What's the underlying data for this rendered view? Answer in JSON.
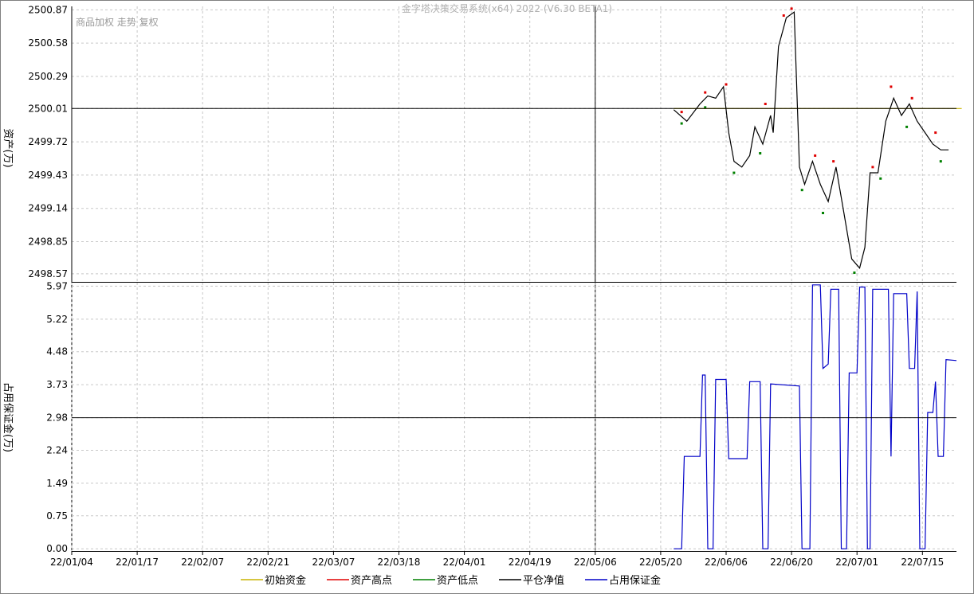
{
  "window": {
    "title": "金字塔决策交易系统(x64) 2022 (V6.30 BETA1)"
  },
  "toolbar": {
    "label": "商品加权 走势 复权"
  },
  "colors": {
    "initial_capital": "#c8b400",
    "asset_high": "#e00000",
    "asset_low": "#008000",
    "close_equity": "#000000",
    "margin_used": "#0000c8",
    "grid": "#c8c8c8",
    "crosshair": "#000000"
  },
  "chart_data": [
    {
      "type": "line",
      "ylabel": "资产(万)",
      "yticks": [
        "2500.87",
        "2500.58",
        "2500.29",
        "2500.01",
        "2499.72",
        "2499.43",
        "2499.14",
        "2498.85",
        "2498.57"
      ],
      "ylim": [
        2498.5,
        2500.9
      ],
      "grid": true,
      "series": [
        {
          "name": "初始资金",
          "values": [
            [
              23,
              2500.01
            ],
            [
              34,
              2500.01
            ]
          ]
        },
        {
          "name": "平仓净值",
          "values": [
            [
              23.0,
              2500.0
            ],
            [
              23.5,
              2499.9
            ],
            [
              24.0,
              2500.05
            ],
            [
              24.3,
              2500.12
            ],
            [
              24.6,
              2500.1
            ],
            [
              24.9,
              2500.2
            ],
            [
              25.1,
              2499.8
            ],
            [
              25.3,
              2499.55
            ],
            [
              25.6,
              2499.5
            ],
            [
              25.9,
              2499.6
            ],
            [
              26.1,
              2499.85
            ],
            [
              26.4,
              2499.7
            ],
            [
              26.7,
              2499.95
            ],
            [
              26.8,
              2499.8
            ],
            [
              27.0,
              2500.55
            ],
            [
              27.3,
              2500.8
            ],
            [
              27.6,
              2500.85
            ],
            [
              27.8,
              2499.5
            ],
            [
              28.0,
              2499.35
            ],
            [
              28.3,
              2499.55
            ],
            [
              28.6,
              2499.35
            ],
            [
              28.9,
              2499.2
            ],
            [
              29.2,
              2499.5
            ],
            [
              29.5,
              2499.1
            ],
            [
              29.8,
              2498.7
            ],
            [
              30.1,
              2498.62
            ],
            [
              30.3,
              2498.8
            ],
            [
              30.5,
              2499.45
            ],
            [
              30.8,
              2499.45
            ],
            [
              31.1,
              2499.9
            ],
            [
              31.4,
              2500.1
            ],
            [
              31.7,
              2499.95
            ],
            [
              32.0,
              2500.05
            ],
            [
              32.3,
              2499.9
            ],
            [
              32.6,
              2499.8
            ],
            [
              32.9,
              2499.7
            ],
            [
              33.2,
              2499.65
            ],
            [
              33.5,
              2499.65
            ]
          ]
        },
        {
          "name": "资产高点",
          "values": [
            [
              23.3,
              2499.98
            ],
            [
              24.2,
              2500.15
            ],
            [
              25.0,
              2500.22
            ],
            [
              26.5,
              2500.05
            ],
            [
              27.2,
              2500.82
            ],
            [
              27.5,
              2500.88
            ],
            [
              28.4,
              2499.6
            ],
            [
              29.1,
              2499.55
            ],
            [
              30.6,
              2499.5
            ],
            [
              31.3,
              2500.2
            ],
            [
              32.1,
              2500.1
            ],
            [
              33.0,
              2499.8
            ]
          ]
        },
        {
          "name": "资产低点",
          "values": [
            [
              23.3,
              2499.88
            ],
            [
              24.2,
              2500.02
            ],
            [
              25.3,
              2499.45
            ],
            [
              26.3,
              2499.62
            ],
            [
              27.9,
              2499.3
            ],
            [
              28.7,
              2499.1
            ],
            [
              29.9,
              2498.58
            ],
            [
              30.9,
              2499.4
            ],
            [
              31.9,
              2499.85
            ],
            [
              33.2,
              2499.55
            ]
          ]
        }
      ]
    },
    {
      "type": "line",
      "ylabel": "占用保证金(万)",
      "yticks": [
        "5.97",
        "5.22",
        "4.48",
        "3.73",
        "2.98",
        "2.24",
        "1.49",
        "0.75",
        "0.00"
      ],
      "ylim": [
        -0.05,
        6.05
      ],
      "grid": true,
      "series": [
        {
          "name": "占用保证金",
          "values": [
            [
              23.0,
              0.0
            ],
            [
              23.3,
              0.0
            ],
            [
              23.4,
              2.1
            ],
            [
              24.0,
              2.1
            ],
            [
              24.1,
              3.95
            ],
            [
              24.2,
              3.95
            ],
            [
              24.3,
              0.0
            ],
            [
              24.5,
              0.0
            ],
            [
              24.6,
              3.85
            ],
            [
              25.0,
              3.85
            ],
            [
              25.1,
              2.05
            ],
            [
              25.8,
              2.05
            ],
            [
              25.9,
              3.8
            ],
            [
              26.3,
              3.8
            ],
            [
              26.4,
              0.0
            ],
            [
              26.6,
              0.0
            ],
            [
              26.7,
              3.75
            ],
            [
              27.8,
              3.7
            ],
            [
              27.9,
              0.0
            ],
            [
              28.2,
              0.0
            ],
            [
              28.3,
              6.0
            ],
            [
              28.6,
              6.0
            ],
            [
              28.7,
              4.1
            ],
            [
              28.9,
              4.2
            ],
            [
              29.0,
              5.9
            ],
            [
              29.3,
              5.9
            ],
            [
              29.4,
              0.0
            ],
            [
              29.6,
              0.0
            ],
            [
              29.7,
              4.0
            ],
            [
              30.0,
              4.0
            ],
            [
              30.1,
              5.95
            ],
            [
              30.3,
              5.95
            ],
            [
              30.4,
              0.0
            ],
            [
              30.5,
              0.0
            ],
            [
              30.6,
              5.9
            ],
            [
              31.2,
              5.9
            ],
            [
              31.3,
              2.1
            ],
            [
              31.4,
              5.8
            ],
            [
              31.9,
              5.8
            ],
            [
              32.0,
              4.1
            ],
            [
              32.2,
              4.1
            ],
            [
              32.3,
              5.85
            ],
            [
              32.4,
              0.0
            ],
            [
              32.6,
              0.0
            ],
            [
              32.7,
              3.1
            ],
            [
              32.9,
              3.1
            ],
            [
              33.0,
              3.8
            ],
            [
              33.1,
              2.1
            ],
            [
              33.3,
              2.1
            ],
            [
              33.4,
              4.3
            ],
            [
              33.8,
              4.28
            ]
          ]
        }
      ]
    }
  ],
  "x_axis": {
    "tick_labels": [
      "22/01/04",
      "22/01/17",
      "22/02/07",
      "22/02/21",
      "22/03/07",
      "22/03/18",
      "22/04/01",
      "22/04/19",
      "22/05/06",
      "22/05/20",
      "22/06/06",
      "22/06/20",
      "22/07/01",
      "22/07/15"
    ],
    "tick_index": [
      0,
      2.5,
      5,
      7.5,
      10,
      12.5,
      15,
      17.5,
      20,
      22.5,
      25,
      27.5,
      30,
      32.5
    ],
    "range": [
      0,
      33.8
    ]
  },
  "crosshair": {
    "x": 20.0,
    "asset_value": 2500.01,
    "margin_value": 2.98
  },
  "legend": [
    {
      "label": "初始资金",
      "color": "#c8b400"
    },
    {
      "label": "资产高点",
      "color": "#e00000"
    },
    {
      "label": "资产低点",
      "color": "#008000"
    },
    {
      "label": "平仓净值",
      "color": "#000000"
    },
    {
      "label": "占用保证金",
      "color": "#0000c8"
    }
  ]
}
